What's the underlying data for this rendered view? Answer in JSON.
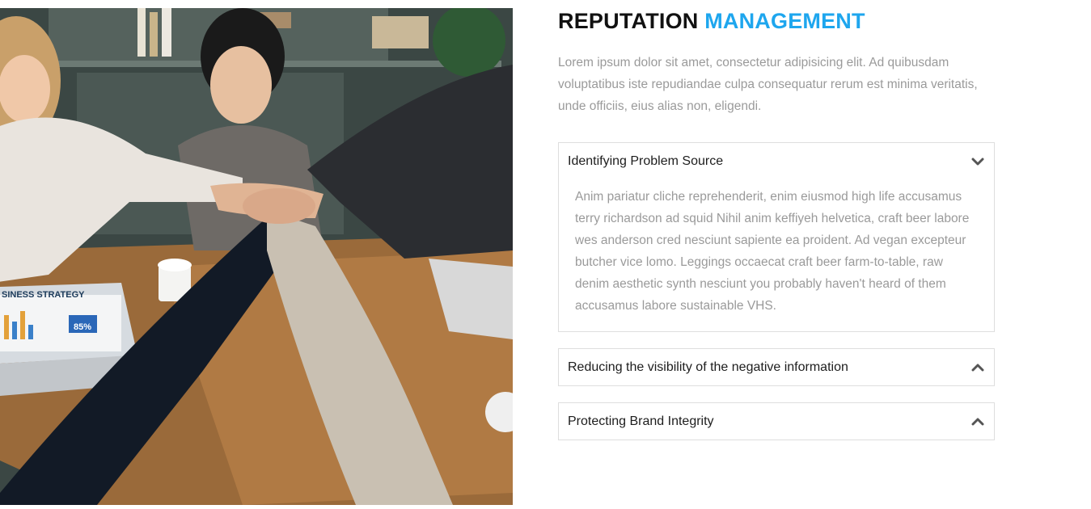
{
  "photo": {
    "description_icon": "team-hands-photo",
    "laptop_screen_title": "SINESS STRATEGY",
    "laptop_screen_stat": "85%"
  },
  "heading": {
    "part1": "REPUTATION",
    "part2": "MANAGEMENT",
    "accent_color": "#1ea6ee"
  },
  "intro": "Lorem ipsum dolor sit amet, consectetur adipisicing elit. Ad quibusdam voluptatibus iste repudiandae culpa consequatur rerum est minima veritatis, unde officiis, eius alias non, eligendi.",
  "accordion": [
    {
      "title": "Identifying Problem Source",
      "icon": "chevron-down-icon",
      "expanded": true,
      "body": "Anim pariatur cliche reprehenderit, enim eiusmod high life accusamus terry richardson ad squid Nihil anim keffiyeh helvetica, craft beer labore wes anderson cred nesciunt sapiente ea proident. Ad vegan excepteur butcher vice lomo. Leggings occaecat craft beer farm-to-table, raw denim aesthetic synth nesciunt you probably haven't heard of them accusamus labore sustainable VHS."
    },
    {
      "title": "Reducing the visibility of the negative information",
      "icon": "chevron-up-icon",
      "expanded": false
    },
    {
      "title": "Protecting Brand Integrity",
      "icon": "chevron-up-icon",
      "expanded": false
    }
  ]
}
